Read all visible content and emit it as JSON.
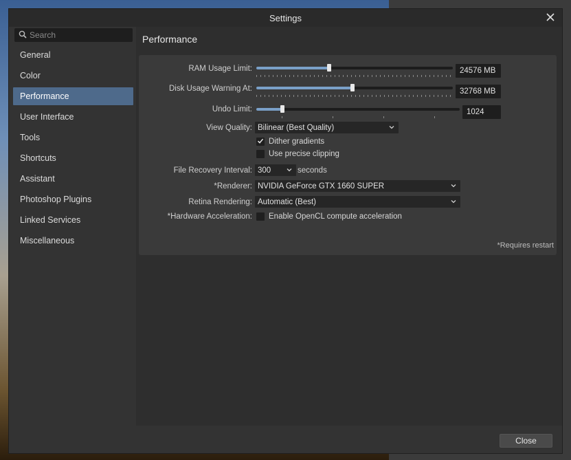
{
  "window": {
    "title": "Settings"
  },
  "search": {
    "placeholder": "Search"
  },
  "sidebar": {
    "items": [
      {
        "label": "General"
      },
      {
        "label": "Color"
      },
      {
        "label": "Performance",
        "active": true
      },
      {
        "label": "User Interface"
      },
      {
        "label": "Tools"
      },
      {
        "label": "Shortcuts"
      },
      {
        "label": "Assistant"
      },
      {
        "label": "Photoshop Plugins"
      },
      {
        "label": "Linked Services"
      },
      {
        "label": "Miscellaneous"
      }
    ]
  },
  "performance": {
    "title": "Performance",
    "ram": {
      "label": "RAM Usage Limit:",
      "value": "24576 MB",
      "fraction": 0.37
    },
    "disk": {
      "label": "Disk Usage Warning At:",
      "value": "32768 MB",
      "fraction": 0.49
    },
    "undo": {
      "label": "Undo Limit:",
      "value": "1024",
      "fraction": 0.13
    },
    "view_quality": {
      "label": "View Quality:",
      "value": "Bilinear (Best Quality)"
    },
    "dither": {
      "label": "Dither gradients",
      "checked": true
    },
    "precise": {
      "label": "Use precise clipping",
      "checked": false
    },
    "recovery": {
      "label": "File Recovery Interval:",
      "value": "300",
      "unit": "seconds"
    },
    "renderer": {
      "label": "*Renderer:",
      "value": "NVIDIA GeForce GTX 1660 SUPER"
    },
    "retina": {
      "label": "Retina Rendering:",
      "value": "Automatic (Best)"
    },
    "hw": {
      "label": "*Hardware Acceleration:",
      "option": "Enable OpenCL compute acceleration",
      "checked": false
    },
    "requires_restart": "*Requires restart"
  },
  "footer": {
    "close_label": "Close"
  },
  "colors": {
    "accent": "#4e6a8b",
    "slider_fill": "#7aa0c8"
  }
}
